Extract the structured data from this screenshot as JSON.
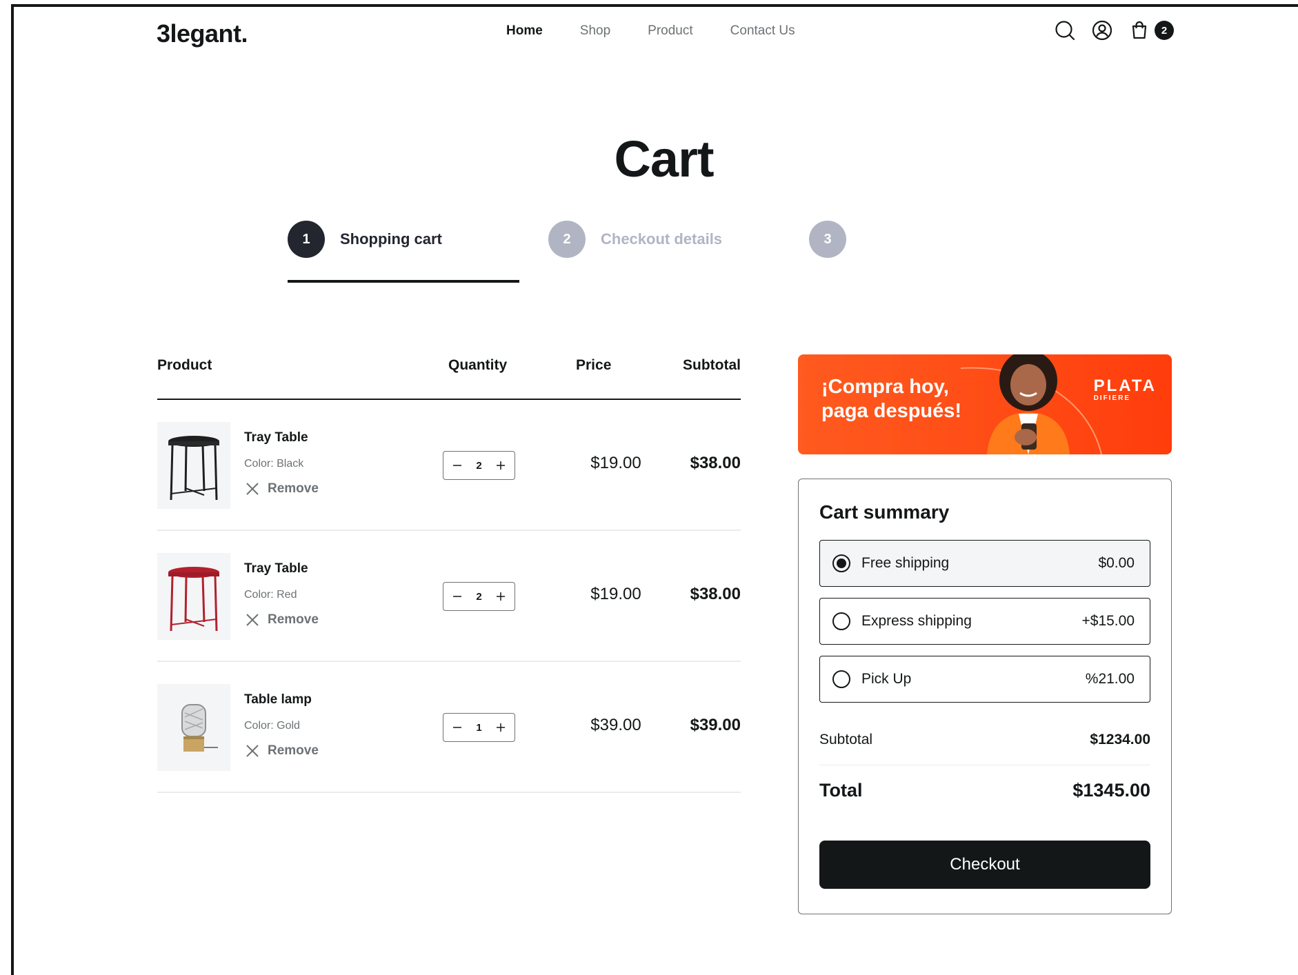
{
  "header": {
    "logo": "3legant.",
    "nav": [
      "Home",
      "Shop",
      "Product",
      "Contact Us"
    ],
    "cart_count": "2",
    "icons": [
      "search-icon",
      "user-icon",
      "shopping-bag-icon"
    ]
  },
  "page_title": "Cart",
  "steps": [
    {
      "num": "1",
      "label": "Shopping cart",
      "state": "active"
    },
    {
      "num": "2",
      "label": "Checkout details",
      "state": "inactive"
    },
    {
      "num": "3",
      "label": "",
      "state": "inactive"
    }
  ],
  "table": {
    "headers": {
      "product": "Product",
      "quantity": "Quantity",
      "price": "Price",
      "subtotal": "Subtotal"
    },
    "remove_label": "Remove",
    "rows": [
      {
        "name": "Tray Table",
        "color": "Color: Black",
        "qty": "2",
        "price": "$19.00",
        "subtotal": "$38.00",
        "product_color_hex": "#1f1f1f"
      },
      {
        "name": "Tray Table",
        "color": "Color: Red",
        "qty": "2",
        "price": "$19.00",
        "subtotal": "$38.00",
        "product_color_hex": "#b3202c"
      },
      {
        "name": "Table lamp",
        "color": "Color: Gold",
        "qty": "1",
        "price": "$39.00",
        "subtotal": "$39.00",
        "product_color_hex": "#c9a464"
      }
    ]
  },
  "banner": {
    "text": "¡Compra hoy,\npaga después!",
    "brand": "PLATA",
    "brand_sub": "DIFIERE",
    "colors": {
      "primary": "#ff4a14"
    }
  },
  "summary": {
    "title": "Cart summary",
    "shipping": [
      {
        "name": "Free shipping",
        "price": "$0.00",
        "selected": true
      },
      {
        "name": "Express shipping",
        "price": "+$15.00",
        "selected": false
      },
      {
        "name": "Pick Up",
        "price": "%21.00",
        "selected": false
      }
    ],
    "subtotal_label": "Subtotal",
    "subtotal_value": "$1234.00",
    "total_label": "Total",
    "total_value": "$1345.00",
    "checkout_label": "Checkout"
  },
  "colors": {
    "dark": "#141718",
    "muted": "#6c7275",
    "step_inactive": "#b1b5c3",
    "divider": "#e8ecef"
  }
}
